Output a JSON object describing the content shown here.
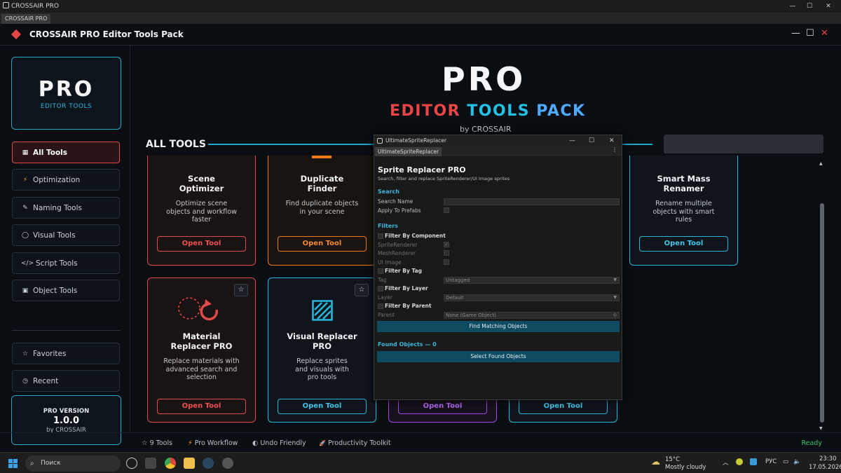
{
  "window": {
    "os_title": "CROSSAIR PRO",
    "tab_label": "CROSSAIR PRO"
  },
  "app": {
    "title": "CROSSAIR PRO Editor Tools Pack"
  },
  "logo": {
    "big": "PRO",
    "small": "EDITOR TOOLS"
  },
  "sidebar": {
    "items": [
      {
        "icon": "▦",
        "label": "All Tools"
      },
      {
        "icon": "⚡",
        "label": "Optimization"
      },
      {
        "icon": "✎",
        "label": "Naming Tools"
      },
      {
        "icon": "◯",
        "label": "Visual Tools"
      },
      {
        "icon": "</>",
        "label": "Script Tools"
      },
      {
        "icon": "▣",
        "label": "Object Tools"
      },
      {
        "icon": "☆",
        "label": "Favorites"
      },
      {
        "icon": "◷",
        "label": "Recent"
      }
    ]
  },
  "version": {
    "label": "PRO VERSION",
    "number": "1.0.0",
    "author": "by CROSSAIR"
  },
  "hero": {
    "pro": "PRO",
    "w1": "EDITOR",
    "w2": "TOOLS",
    "w3": "PACK",
    "by": "by CROSSAIR"
  },
  "section": {
    "title": "ALL TOOLS"
  },
  "cards": [
    {
      "title": "Scene Optimizer",
      "desc": "Optimize scene objects and workflow faster",
      "button": "Open Tool",
      "accent": "#e04a4a"
    },
    {
      "title": "Duplicate Finder",
      "desc": "Find duplicate objects in your scene",
      "button": "Open Tool",
      "accent": "#f07a1a"
    },
    {
      "title": "Smart Mass Renamer",
      "desc": "Rename multiple objects with smart rules",
      "button": "Open Tool",
      "accent": "#27b6dc"
    },
    {
      "title": "Material Replacer PRO",
      "desc": "Replace materials with advanced search and selection",
      "button": "Open Tool",
      "accent": "#e04a4a"
    },
    {
      "title": "Visual Replacer PRO",
      "desc": "Replace sprites and visuals with pro tools",
      "button": "Open Tool",
      "accent": "#27b6dc"
    },
    {
      "title": "",
      "desc": "",
      "button": "Open Tool",
      "accent": "#a347e6"
    },
    {
      "title": "",
      "desc": "",
      "button": "Open Tool",
      "accent": "#27b6dc"
    }
  ],
  "star_glyph": "☆",
  "status": {
    "items": [
      {
        "icon": "☆",
        "label": "9 Tools"
      },
      {
        "icon": "⚡",
        "label": "Pro Workflow"
      },
      {
        "icon": "◐",
        "label": "Undo Friendly"
      },
      {
        "icon": "🚀",
        "label": "Productivity Toolkit"
      }
    ],
    "ready": "Ready"
  },
  "popup": {
    "window_title": "UltimateSpriteReplacer",
    "tab": "UltimateSpriteReplacer",
    "title": "Sprite Replacer PRO",
    "subtitle": "Search, filter and replace SpriteRenderer/UI Image sprites",
    "search_section": "Search",
    "search_name_label": "Search Name",
    "apply_prefabs_label": "Apply To Prefabs",
    "filters_section": "Filters",
    "filter_by_component": "Filter By Component",
    "sprite_renderer": "SpriteRenderer",
    "mesh_renderer": "MeshRenderer",
    "ui_image": "UI Image",
    "filter_by_tag": "Filter By Tag",
    "tag_label": "Tag",
    "tag_value": "Untagged",
    "filter_by_layer": "Filter By Layer",
    "layer_label": "Layer",
    "layer_value": "Default",
    "filter_by_parent": "Filter By Parent",
    "parent_label": "Parent",
    "parent_value": "None (Game Object)",
    "find_button": "Find Matching Objects",
    "found_label": "Found Objects — 0",
    "select_button": "Select Found Objects"
  },
  "taskbar": {
    "search_placeholder": "Поиск",
    "weather_temp": "15°C",
    "weather_desc": "Mostly cloudy",
    "lang": "РУС",
    "time": "23:30",
    "date": "17.05.2026"
  }
}
